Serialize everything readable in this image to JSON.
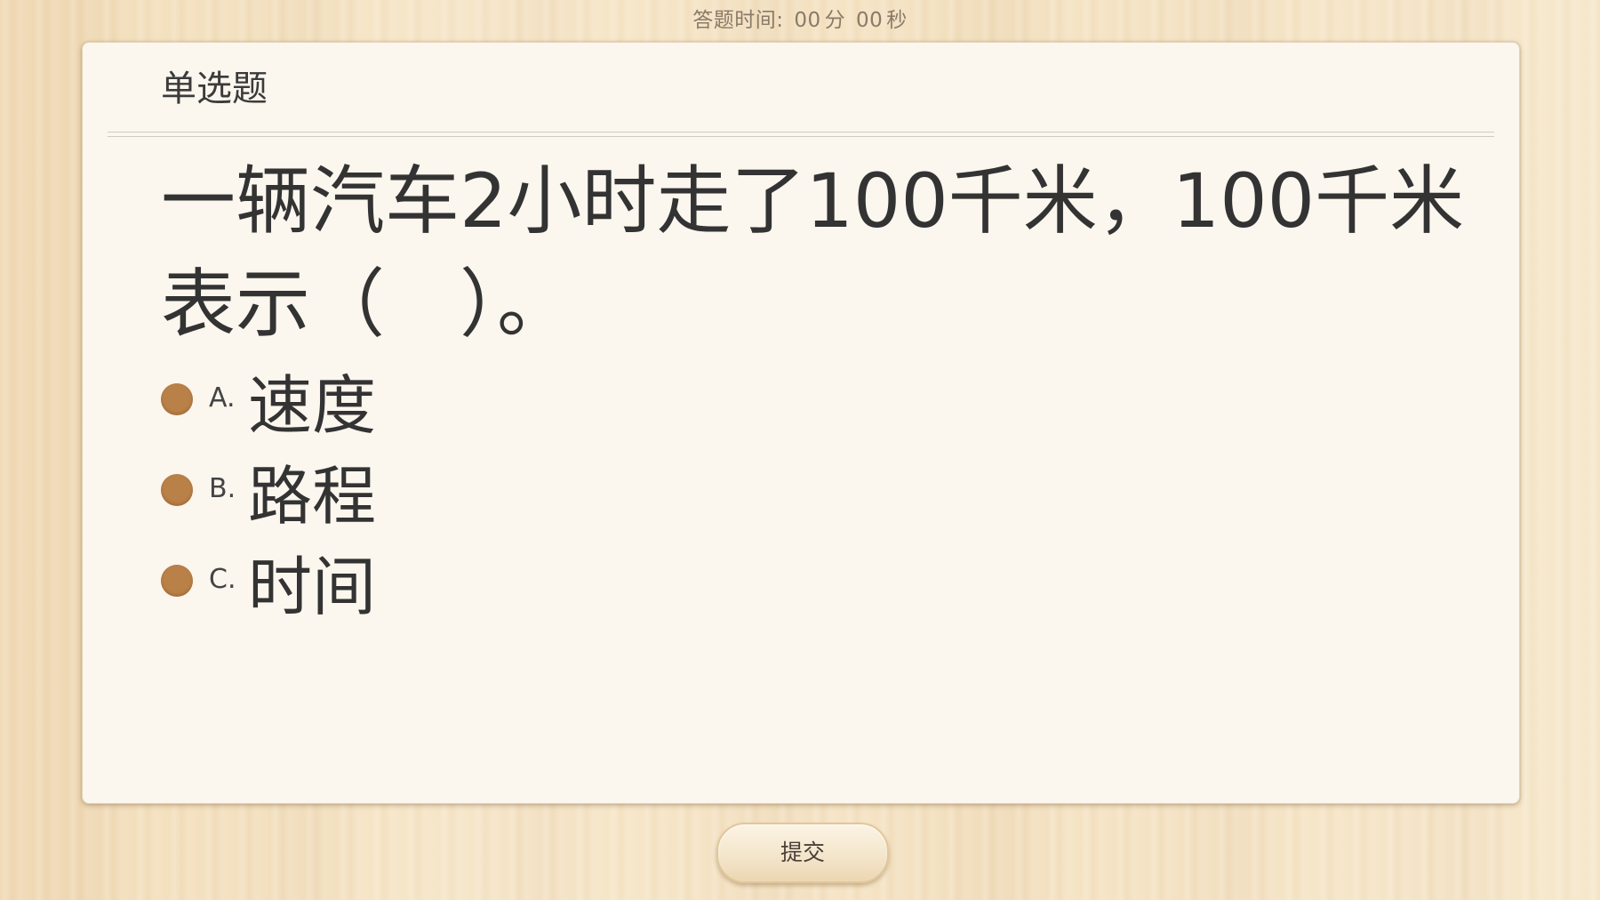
{
  "timer": {
    "label": "答题时间:",
    "minutes": "00",
    "minutes_unit": "分",
    "seconds": "00",
    "seconds_unit": "秒"
  },
  "question": {
    "type": "单选题",
    "text": "一辆汽车2小时走了100千米，100千米表示（　）。"
  },
  "options": [
    {
      "letter": "A.",
      "text": "速度"
    },
    {
      "letter": "B.",
      "text": "路程"
    },
    {
      "letter": "C.",
      "text": "时间"
    }
  ],
  "submit": {
    "label": "提交"
  },
  "colors": {
    "radio": "#b98047",
    "card_background": "#fbf6ee",
    "page_background": "#f2dfbf"
  }
}
